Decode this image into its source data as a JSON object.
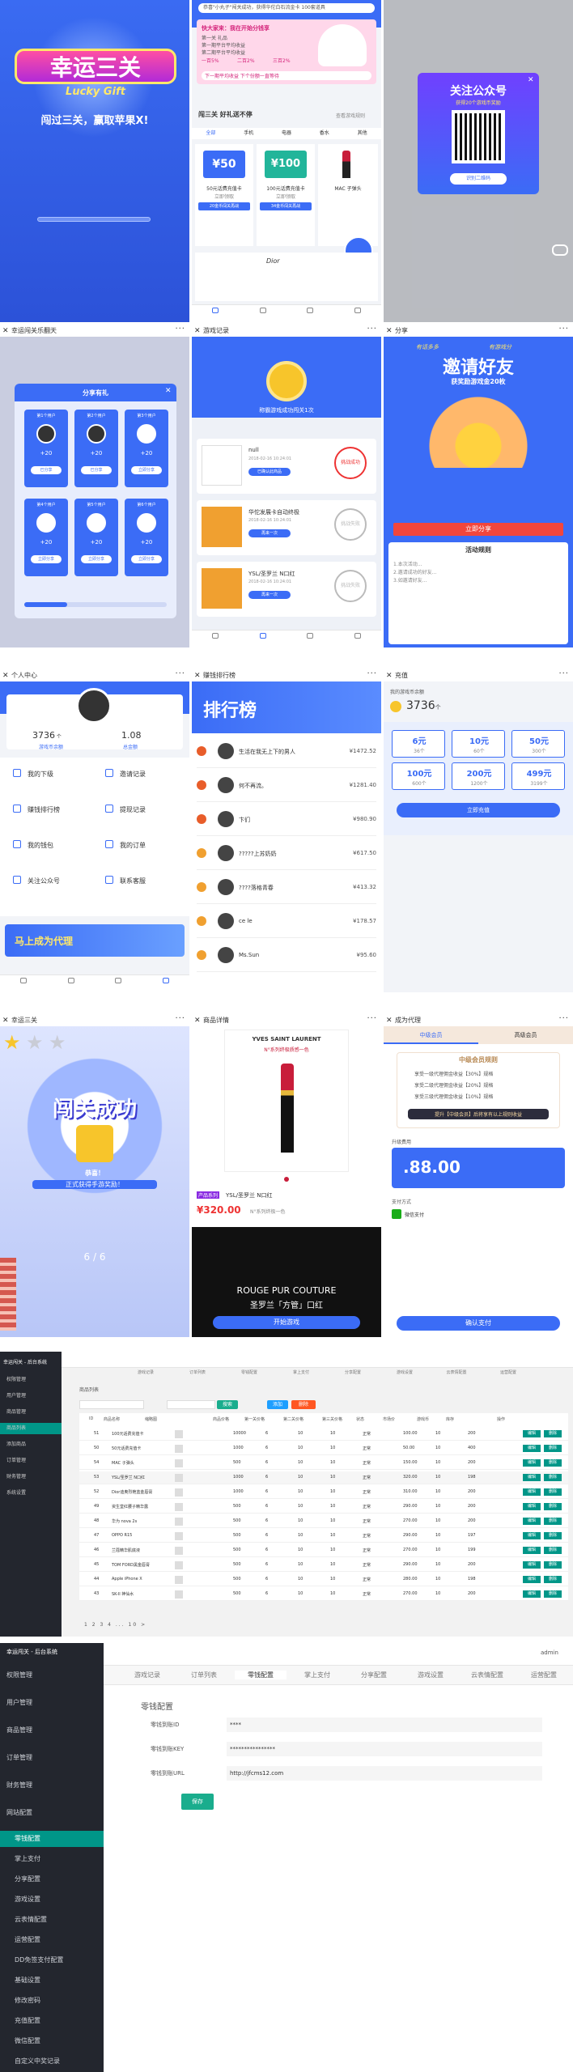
{
  "p1": {
    "title_cn": "幸运三关",
    "title_en": "Lucky Gift",
    "slogan": "闯过三关，赢取苹果X!"
  },
  "p2": {
    "notice": "恭喜\"小丸子\"闯关成功，获得华佗白石流金卡 100套道具",
    "banner_title": "快大家来：我在开始分钱享",
    "banner_lines": [
      "第一关 礼品",
      "第一期平台平均收益",
      "第二期平台平均收益"
    ],
    "pct": [
      "一百5%",
      "二百2%",
      "三百2%"
    ],
    "banner_foot": "下一期平均收益 下个份额一直等待",
    "label_tongzhi": "通知",
    "tab_title": "闯三关 好礼送不停",
    "tab_link": "查看游戏规则",
    "cats": [
      "全部",
      "手机",
      "电器",
      "香水",
      "其他"
    ],
    "products": [
      {
        "price": "¥50",
        "name": "50元话费充值卡",
        "sub": "立即领取",
        "btn": "20金币闯关再战"
      },
      {
        "price": "¥100",
        "name": "100元话费充值卡",
        "sub": "立即领取",
        "btn": "34金币闯关再战"
      },
      {
        "price": "",
        "name": "MAC 子弹头",
        "sub": "",
        "btn": ""
      }
    ],
    "brands": [
      "Dior",
      ""
    ]
  },
  "p3": {
    "title": "关注公众号",
    "sub": "获得20个游戏币奖励",
    "btn": "识别二维码"
  },
  "p4": {
    "title": "幸运闯关乐翻天",
    "modal": "分享有礼",
    "cards": [
      {
        "top": "第1个用户",
        "n": "+20",
        "btn": "已分享"
      },
      {
        "top": "第2个用户",
        "n": "+20",
        "btn": "已分享"
      },
      {
        "top": "第3个用户",
        "n": "+20",
        "btn": "立即分享"
      },
      {
        "top": "第4个用户",
        "n": "+20",
        "btn": "立即分享"
      },
      {
        "top": "第5个用户",
        "n": "+20",
        "btn": "立即分享"
      },
      {
        "top": "第6个用户",
        "n": "+20",
        "btn": "立即分享"
      }
    ],
    "progress": 0.3
  },
  "p5": {
    "title": "游戏记录",
    "medal": "称霸游戏成功闯关1次",
    "items": [
      {
        "name": "null",
        "date": "2018-02-16 10:24:01",
        "btn": "已确认此商品",
        "status": "挑战成功"
      },
      {
        "name": "华佗发展卡自动终极",
        "date": "2018-02-16 10:24:01",
        "btn": "再来一次",
        "status": "挑战失败"
      },
      {
        "name": "YSL/圣罗兰 N口红",
        "date": "2018-02-16 10:24:01",
        "btn": "再来一次",
        "status": "挑战失败"
      }
    ]
  },
  "p6": {
    "title": "分享",
    "tag1": "有话多多",
    "tag2": "有游戏分",
    "big": "邀请好友",
    "sub": "获奖励游戏金20枚",
    "btn": "立即分享",
    "rules": "活动规则",
    "rule_lines": [
      "1.本次活动...",
      "2.邀请成功的好友...",
      "3.如邀请好友..."
    ]
  },
  "p7": {
    "title": "个人中心",
    "coins": "3736",
    "coins_label": "游戏币余额",
    "money": "1.08",
    "money_label": "总金额",
    "menu": [
      [
        "我的下级",
        "邀请记录"
      ],
      [
        "赚钱排行榜",
        "提现记录"
      ],
      [
        "我的钱包",
        "我的订单"
      ],
      [
        "关注公众号",
        "联系客服"
      ]
    ],
    "banner": "马上成为代理"
  },
  "p8": {
    "title": "赚钱排行榜",
    "banner": "排行榜",
    "rows": [
      {
        "name": "生活在我无上下的男人",
        "amount": "¥1472.52"
      },
      {
        "name": "何不再流。",
        "amount": "¥1281.40"
      },
      {
        "name": "卞们",
        "amount": "¥980.90"
      },
      {
        "name": "?????上苏奶奶",
        "amount": "¥617.50"
      },
      {
        "name": "????落格青春",
        "amount": "¥413.32"
      },
      {
        "name": "ce le",
        "amount": "¥178.57"
      },
      {
        "name": "Ms.Sun",
        "amount": "¥95.60"
      }
    ]
  },
  "p9": {
    "title": "充值",
    "balance_label": "我的游戏币余额",
    "balance": "3736",
    "unit": "个",
    "options": [
      {
        "v": "6元",
        "c": "36个"
      },
      {
        "v": "10元",
        "c": "60个"
      },
      {
        "v": "50元",
        "c": "300个"
      },
      {
        "v": "100元",
        "c": "600个"
      },
      {
        "v": "200元",
        "c": "1200个"
      },
      {
        "v": "499元",
        "c": "3199个"
      }
    ],
    "btn": "立即充值"
  },
  "p10": {
    "title": "幸运三关",
    "big": "闯关成功",
    "sub": "恭喜！",
    "sub2": "正式获得手游奖励！",
    "progress": "6 / 6"
  },
  "p11": {
    "title": "商品详情",
    "brand": "YVES SAINT LAURENT",
    "desc": "N°系列终极质感一色",
    "tag": "产品系列",
    "name": "YSL/圣罗兰 N口红",
    "price": "¥320.00",
    "note": "N°系列终极一色",
    "ad1": "ROUGE PUR COUTURE",
    "ad2": "圣罗兰「方管」口红",
    "btn": "开始游戏"
  },
  "p12": {
    "title": "成为代理",
    "tab1": "中级会员",
    "tab2": "高级会员",
    "card": "中级会员规则",
    "lines": [
      "享受一级代理佣金收益【30%】规格",
      "享受二级代理佣金收益【20%】规格",
      "享受三级代理佣金收益【10%】规格"
    ],
    "upgrade": "提升【中级会员】后将享有以上规则收益",
    "price_label": "升级费用",
    "price": ".88.00",
    "pay_label": "支付方式",
    "pay": "微信支付",
    "btn": "确认支付"
  },
  "admin1": {
    "logo": "幸运闯关 - 后台系统",
    "side": [
      "权限管理",
      "用户管理",
      "商品管理",
      "商品列表",
      "添加商品",
      "订单管理",
      "财务管理",
      "系统设置"
    ],
    "tabs": [
      "游戏记录",
      "订单列表",
      "零钱配置",
      "掌上支付",
      "分享配置",
      "游戏设置",
      "云表情配置",
      "运营配置"
    ],
    "panel": "商品列表",
    "btns": [
      "搜索",
      "添加",
      "删除"
    ],
    "heads": [
      "ID",
      "商品名称",
      "缩略图",
      "商品价格",
      "第一关价格",
      "第二关价格",
      "第三关价格",
      "状态",
      "市场价",
      "游戏币",
      "库存",
      "操作"
    ],
    "rows": [
      [
        "51",
        "100元话费充值卡",
        "",
        "10000",
        "6",
        "10",
        "10",
        "正常",
        "100.00",
        "10",
        "200"
      ],
      [
        "50",
        "50元话费充值卡",
        "",
        "1000",
        "6",
        "10",
        "10",
        "正常",
        "50.00",
        "10",
        "400"
      ],
      [
        "54",
        "MAC 子弹头",
        "",
        "500",
        "6",
        "10",
        "10",
        "正常",
        "150.00",
        "10",
        "200"
      ],
      [
        "53",
        "YSL/圣罗兰 N口红",
        "",
        "1000",
        "6",
        "10",
        "10",
        "正常",
        "320.00",
        "10",
        "198"
      ],
      [
        "52",
        "Dior迪奥烈艳蓝金唇膏",
        "",
        "1000",
        "6",
        "10",
        "10",
        "正常",
        "310.00",
        "10",
        "200"
      ],
      [
        "49",
        "资生堂红腰子精华露",
        "",
        "500",
        "6",
        "10",
        "10",
        "正常",
        "290.00",
        "10",
        "200"
      ],
      [
        "48",
        "华为 nova 2s",
        "",
        "500",
        "6",
        "10",
        "10",
        "正常",
        "270.00",
        "10",
        "200"
      ],
      [
        "47",
        "OPPO R15",
        "",
        "500",
        "6",
        "10",
        "10",
        "正常",
        "290.00",
        "10",
        "197"
      ],
      [
        "46",
        "兰蔻精华肌底液",
        "",
        "500",
        "6",
        "10",
        "10",
        "正常",
        "270.00",
        "10",
        "199"
      ],
      [
        "45",
        "TOM FORD黑金唇膏",
        "",
        "500",
        "6",
        "10",
        "10",
        "正常",
        "290.00",
        "10",
        "200"
      ],
      [
        "44",
        "Apple iPhone X",
        "",
        "500",
        "6",
        "10",
        "10",
        "正常",
        "280.00",
        "10",
        "198"
      ],
      [
        "43",
        "SK-II 神仙水",
        "",
        "500",
        "6",
        "10",
        "10",
        "正常",
        "270.00",
        "10",
        "200"
      ]
    ],
    "op_edit": "编辑",
    "op_del": "删除",
    "pager": "1 2 3 4 ... 10 >"
  },
  "admin2": {
    "logo": "幸运闯关 - 后台系统",
    "side": [
      "权限管理",
      "用户管理",
      "商品管理",
      "订单管理",
      "财务管理",
      "网站配置",
      "零钱配置",
      "掌上支付",
      "分享配置",
      "游戏设置",
      "云表情配置",
      "运营配置",
      "DD免签支付配置",
      "基础设置",
      "修改密码",
      "充值配置",
      "微信配置",
      "自定义中奖记录"
    ],
    "tabs": [
      "游戏记录",
      "订单列表",
      "零钱配置",
      "掌上支付",
      "分享配置",
      "游戏设置",
      "云表情配置",
      "运营配置"
    ],
    "user": "admin",
    "panel": "零钱配置",
    "f1_label": "零钱到账ID",
    "f1_val": "****",
    "f2_label": "零钱到账KEY",
    "f2_val": "****************",
    "f3_label": "零钱到账URL",
    "f3_val": "http://jfcms12.com",
    "save": "保存"
  }
}
